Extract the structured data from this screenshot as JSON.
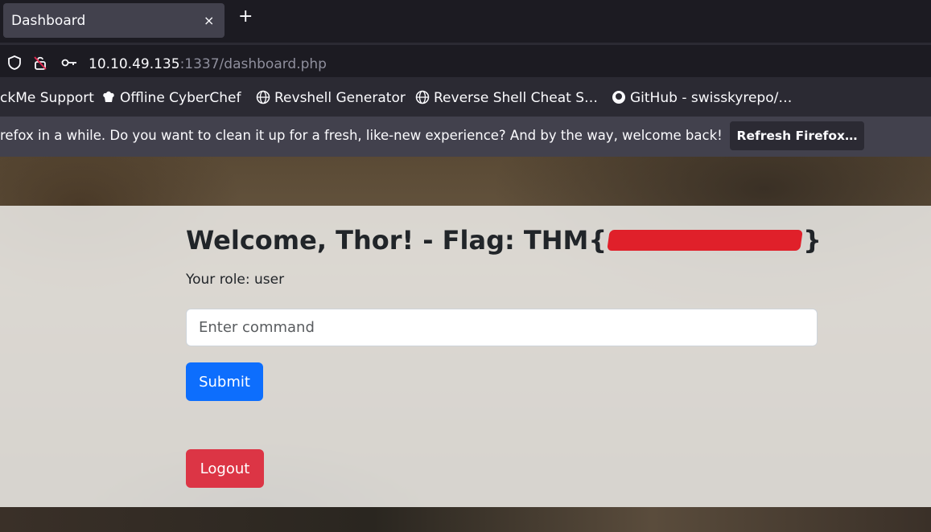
{
  "browser": {
    "tab_title": "Dashboard",
    "tab_close": "×",
    "new_tab": "+",
    "url_host": "10.10.49.135",
    "url_rest": ":1337/dashboard.php",
    "bookmarks": [
      "ckMe Support",
      "Offline CyberChef",
      "Revshell Generator",
      "Reverse Shell Cheat S…",
      "GitHub - swisskyrepo/…"
    ],
    "notice_text": "refox in a while. Do you want to clean it up for a fresh, like-new experience? And by the way, welcome back!",
    "refresh_button": "Refresh Firefox…"
  },
  "dashboard": {
    "welcome_prefix": "Welcome, Thor! - Flag: THM{",
    "welcome_suffix": "}",
    "role_text": "Your role: user",
    "command_placeholder": "Enter command",
    "submit_label": "Submit",
    "logout_label": "Logout"
  },
  "colors": {
    "submit": "#0d6efd",
    "logout": "#dc3545",
    "redaction": "#e0202a"
  }
}
